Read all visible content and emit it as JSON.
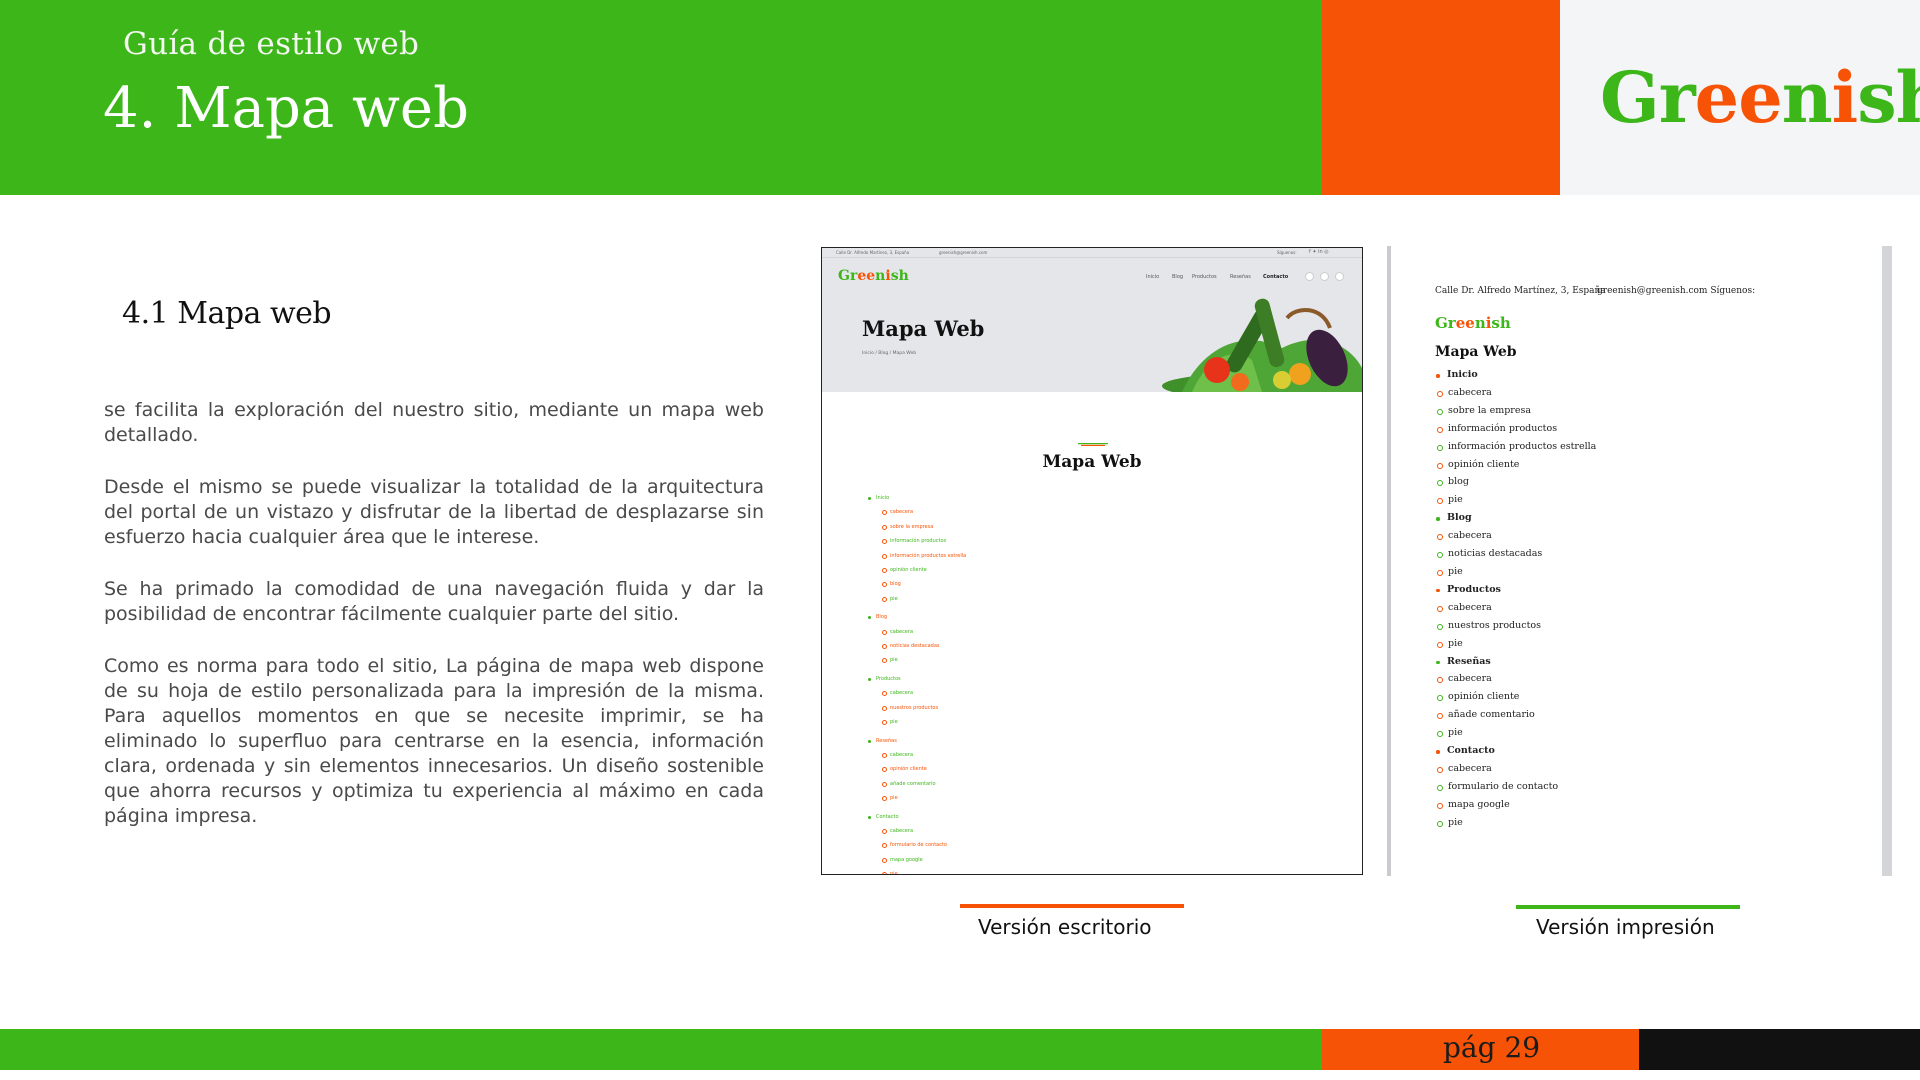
{
  "header": {
    "subtitle": "Guía de estilo web",
    "title": "4. Mapa web",
    "logo": {
      "part1": "Gr",
      "part2": "ee",
      "part3": "n",
      "part4": "i",
      "part5": "sh"
    },
    "colors": {
      "green": "#3cb619",
      "orange": "#f75306",
      "light": "#f4f5f7"
    }
  },
  "section": {
    "title": "4.1 Mapa web",
    "paragraphs": [
      "se facilita la exploración del nuestro sitio, mediante un mapa web detallado.",
      "Desde el mismo se puede visualizar la totalidad de la arquitectura del portal de un vistazo y disfrutar de la libertad de desplazarse sin esfuerzo hacia cualquier área que le interese.",
      "Se ha primado la comodidad de una navegación fluida y dar la posibilidad de encontrar fácilmente cualquier parte del sitio.",
      "Como es norma para todo el sitio, La página de mapa web dispone de su hoja de estilo personalizada para la impresión de la misma. Para aquellos momentos en que se necesite imprimir, se ha eliminado lo superfluo para centrarse en la esencia, información clara, ordenada y sin elementos innecesarios. Un diseño sostenible que ahorra recursos y optimiza tu experiencia al máximo en cada página impresa."
    ]
  },
  "desktop": {
    "address": "Calle Dr. Alfredo Martínez, 3, España",
    "email": "greenish@greenish.com",
    "follow": "Síguenos:",
    "nav": [
      "Inicio",
      "Blog",
      "Productos",
      "Reseñas",
      "Contacto"
    ],
    "hero_title": "Mapa Web",
    "breadcrumb": "Inicio  /  Blog  /  Mapa Web",
    "heading": "Mapa Web",
    "sitemap": [
      {
        "label": "Inicio",
        "items": [
          "cabecera",
          "sobre la empresa",
          "información productos",
          "información productos estrella",
          "opinión cliente",
          "blog",
          "pie"
        ]
      },
      {
        "label": "Blog",
        "items": [
          "cabecera",
          "noticias destacadas",
          "pie"
        ]
      },
      {
        "label": "Productos",
        "items": [
          "cabecera",
          "nuestros productos",
          "pie"
        ]
      },
      {
        "label": "Reseñas",
        "items": [
          "cabecera",
          "opinión cliente",
          "añade comentario",
          "pie"
        ]
      },
      {
        "label": "Contacto",
        "items": [
          "cabecera",
          "formulario de contacto",
          "mapa google",
          "pie"
        ]
      }
    ]
  },
  "print": {
    "address": "Calle Dr. Alfredo Martínez, 3, España",
    "email_follow": "greenish@greenish.com Síguenos:",
    "heading": "Mapa Web"
  },
  "captions": {
    "desktop": "Versión escritorio",
    "print": "Versión impresión"
  },
  "footer": {
    "page": "pág 29"
  }
}
